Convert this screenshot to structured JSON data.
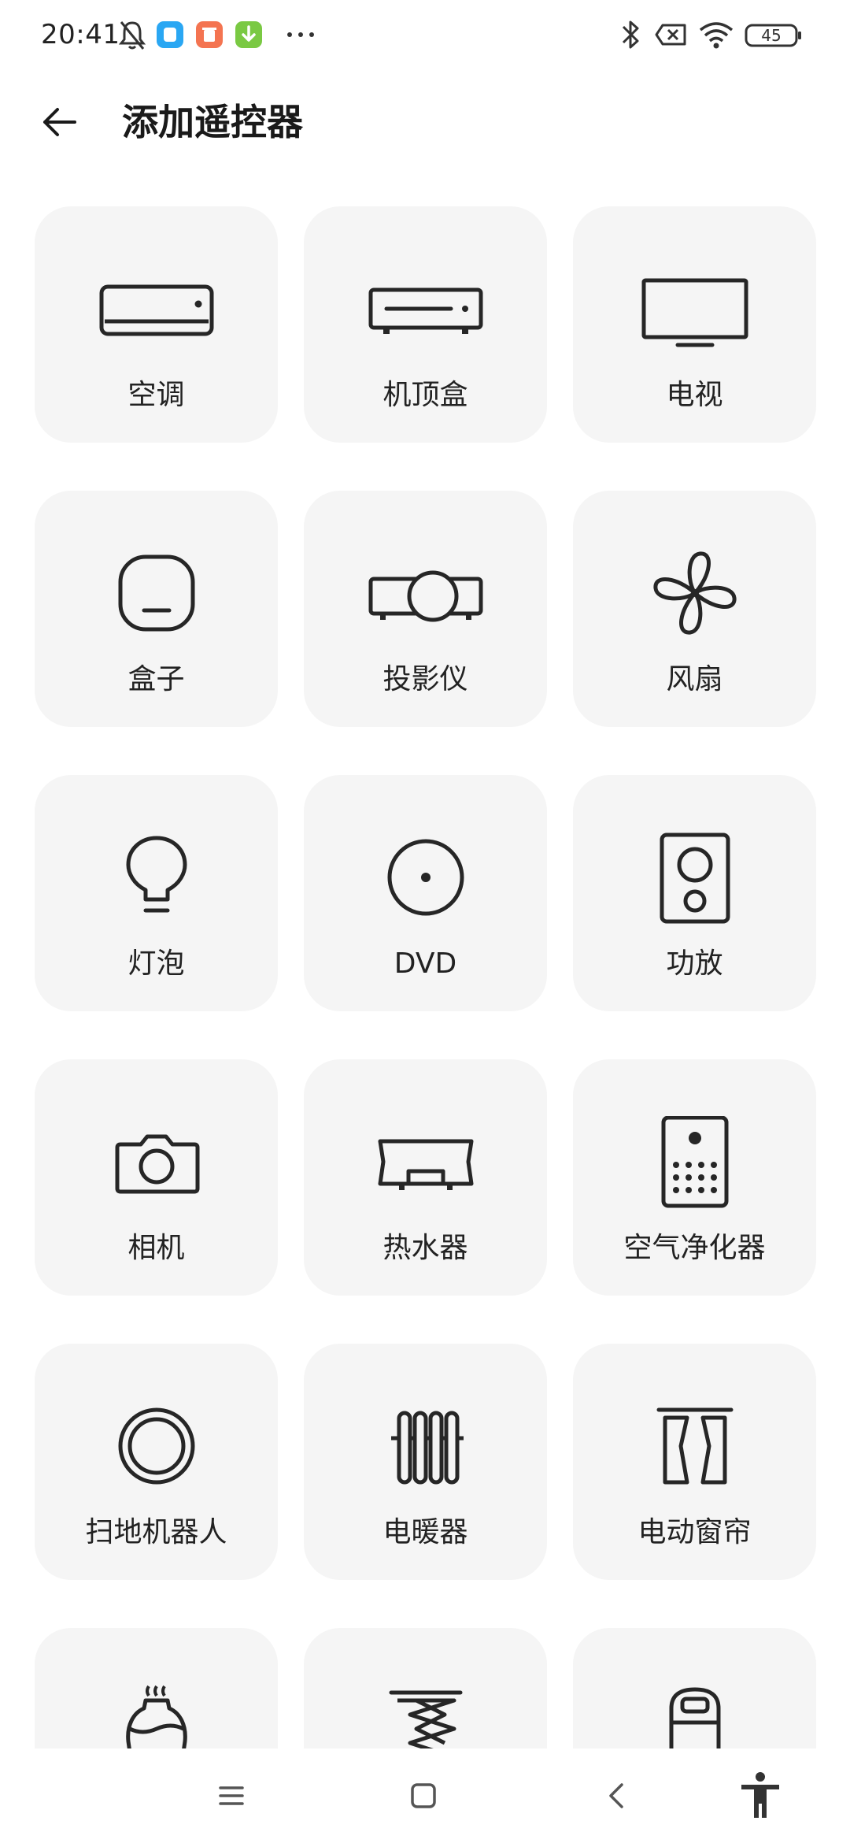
{
  "status_bar": {
    "time": "20:41",
    "battery": "45",
    "icons": [
      "notification-muted-icon",
      "app-notification-blue-icon",
      "app-notification-orange-icon",
      "app-notification-green-download-icon",
      "more-dots-icon",
      "bluetooth-icon",
      "no-sim-icon",
      "wifi-icon",
      "battery-icon"
    ]
  },
  "header": {
    "title": "添加遥控器",
    "back_icon": "back-arrow-icon"
  },
  "devices": [
    {
      "label": "空调",
      "icon": "air-conditioner-icon"
    },
    {
      "label": "机顶盒",
      "icon": "set-top-box-icon"
    },
    {
      "label": "电视",
      "icon": "tv-icon"
    },
    {
      "label": "盒子",
      "icon": "media-box-icon"
    },
    {
      "label": "投影仪",
      "icon": "projector-icon"
    },
    {
      "label": "风扇",
      "icon": "fan-icon"
    },
    {
      "label": "灯泡",
      "icon": "light-bulb-icon"
    },
    {
      "label": "DVD",
      "icon": "dvd-icon"
    },
    {
      "label": "功放",
      "icon": "speaker-icon"
    },
    {
      "label": "相机",
      "icon": "camera-icon"
    },
    {
      "label": "热水器",
      "icon": "water-heater-icon"
    },
    {
      "label": "空气净化器",
      "icon": "air-purifier-icon"
    },
    {
      "label": "扫地机器人",
      "icon": "robot-vacuum-icon"
    },
    {
      "label": "电暖器",
      "icon": "electric-heater-icon"
    },
    {
      "label": "电动窗帘",
      "icon": "curtain-icon"
    },
    {
      "label": "",
      "icon": "humidifier-icon"
    },
    {
      "label": "",
      "icon": "heater-coil-icon"
    },
    {
      "label": "",
      "icon": "appliance-icon"
    }
  ],
  "nav_bar": {
    "icons": [
      "menu-icon",
      "home-icon",
      "back-icon",
      "accessibility-icon"
    ]
  },
  "colors": {
    "background": "#ffffff",
    "card": "#f5f5f5",
    "icon_stroke": "#262626",
    "text": "#222222"
  }
}
